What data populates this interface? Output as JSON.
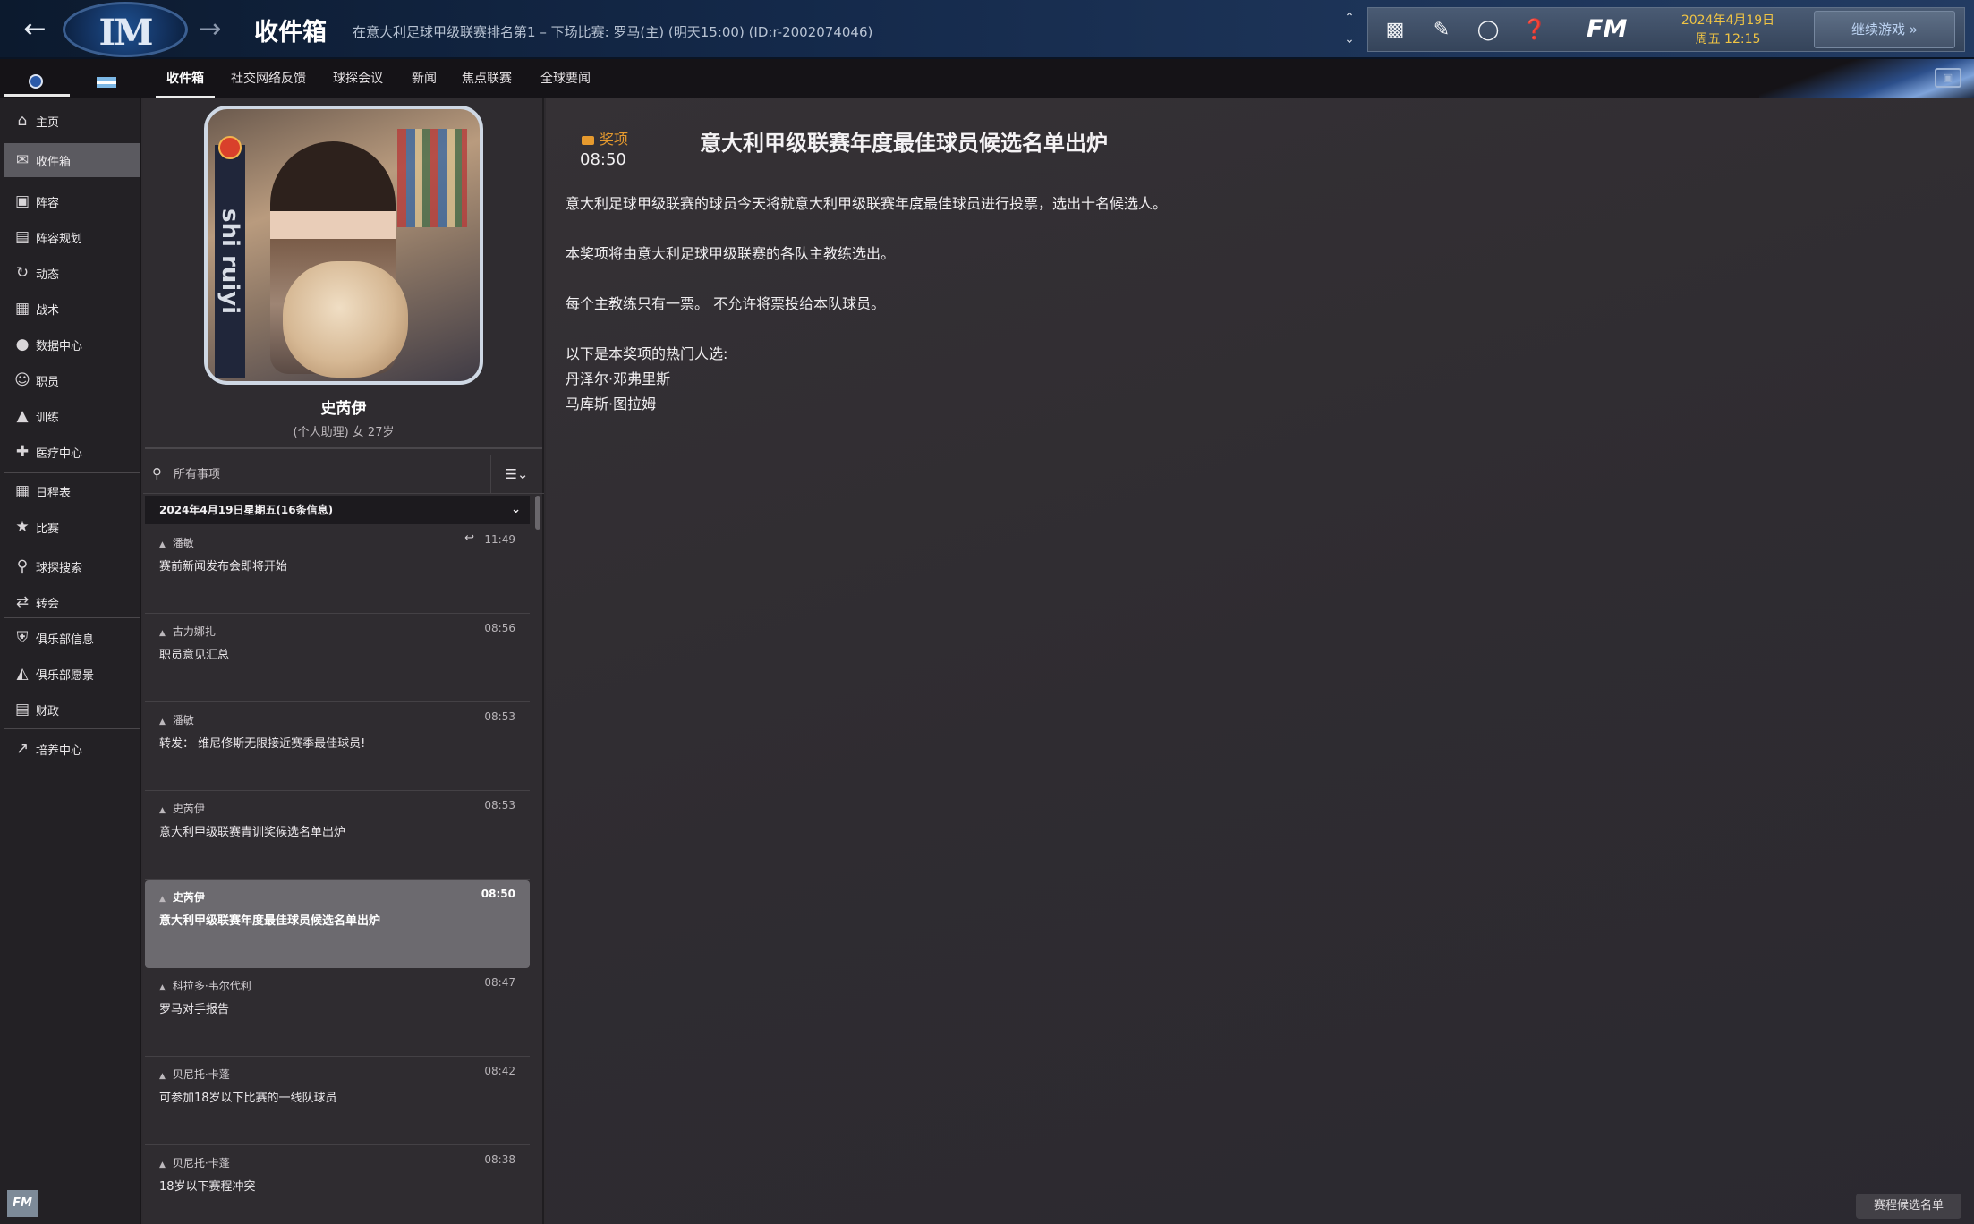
{
  "header": {
    "title": "收件箱",
    "subtitle": "在意大利足球甲级联赛排名第1 – 下场比赛: 罗马(主) (明天15:00) (ID:r-2002074046)",
    "fm_logo": "FM",
    "date_line1": "2024年4月19日",
    "date_line2": "周五 12:15",
    "continue_label": "继续游戏 »",
    "club_logo_text": "IM"
  },
  "tabs": [
    {
      "label": "收件箱",
      "active": true
    },
    {
      "label": "社交网络反馈"
    },
    {
      "label": "球探会议"
    },
    {
      "label": "新闻"
    },
    {
      "label": "焦点联赛"
    },
    {
      "label": "全球要闻"
    }
  ],
  "sidebar": {
    "items": [
      {
        "label": "主页",
        "icon": "home-icon"
      },
      {
        "label": "收件箱",
        "icon": "inbox-icon",
        "active": true
      },
      {
        "label": "阵容",
        "icon": "shirt-icon"
      },
      {
        "label": "阵容规划",
        "icon": "clipboard-icon"
      },
      {
        "label": "动态",
        "icon": "dynamics-icon"
      },
      {
        "label": "战术",
        "icon": "tactics-icon"
      },
      {
        "label": "数据中心",
        "icon": "data-icon"
      },
      {
        "label": "职员",
        "icon": "staff-icon"
      },
      {
        "label": "训练",
        "icon": "training-icon"
      },
      {
        "label": "医疗中心",
        "icon": "medical-icon"
      },
      {
        "label": "日程表",
        "icon": "calendar-icon"
      },
      {
        "label": "比赛",
        "icon": "trophy-icon"
      },
      {
        "label": "球探搜索",
        "icon": "search-icon"
      },
      {
        "label": "转会",
        "icon": "transfer-icon"
      },
      {
        "label": "俱乐部信息",
        "icon": "shield-icon"
      },
      {
        "label": "俱乐部愿景",
        "icon": "vision-icon"
      },
      {
        "label": "财政",
        "icon": "money-icon"
      },
      {
        "label": "培养中心",
        "icon": "development-icon"
      }
    ],
    "fm_badge": "FM"
  },
  "person": {
    "name": "史芮伊",
    "meta": "(个人助理)  女  27岁",
    "photo_side_text": "shi ruiyi"
  },
  "search": {
    "placeholder": "所有事项"
  },
  "date_group": "2024年4月19日星期五(16条信息)",
  "messages": [
    {
      "sender": "潘敏",
      "time": "11:49",
      "subject": "赛前新闻发布会即将开始",
      "replied": true
    },
    {
      "sender": "古力娜扎",
      "time": "08:56",
      "subject": "职员意见汇总"
    },
    {
      "sender": "潘敏",
      "time": "08:53",
      "subject": "转发： 维尼修斯无限接近赛季最佳球员!"
    },
    {
      "sender": "史芮伊",
      "time": "08:53",
      "subject": "意大利甲级联赛青训奖候选名单出炉"
    },
    {
      "sender": "史芮伊",
      "time": "08:50",
      "subject": "意大利甲级联赛年度最佳球员候选名单出炉",
      "active": true
    },
    {
      "sender": "科拉多·韦尔代利",
      "time": "08:47",
      "subject": "罗马对手报告"
    },
    {
      "sender": "贝尼托·卡蓬",
      "time": "08:42",
      "subject": "可参加18岁以下比赛的一线队球员"
    },
    {
      "sender": "贝尼托·卡蓬",
      "time": "08:38",
      "subject": "18岁以下赛程冲突"
    }
  ],
  "detail": {
    "category": "奖项",
    "time": "08:50",
    "title": "意大利甲级联赛年度最佳球员候选名单出炉",
    "para1": "意大利足球甲级联赛的球员今天将就意大利甲级联赛年度最佳球员进行投票，选出十名候选人。",
    "para2": "本奖项将由意大利足球甲级联赛的各队主教练选出。",
    "para3": "每个主教练只有一票。 不允许将票投给本队球员。",
    "para4": "以下是本奖项的热门人选:",
    "candidate1": "丹泽尔·邓弗里斯",
    "candidate2": "马库斯·图拉姆"
  },
  "watermark": "赛程候选名单"
}
